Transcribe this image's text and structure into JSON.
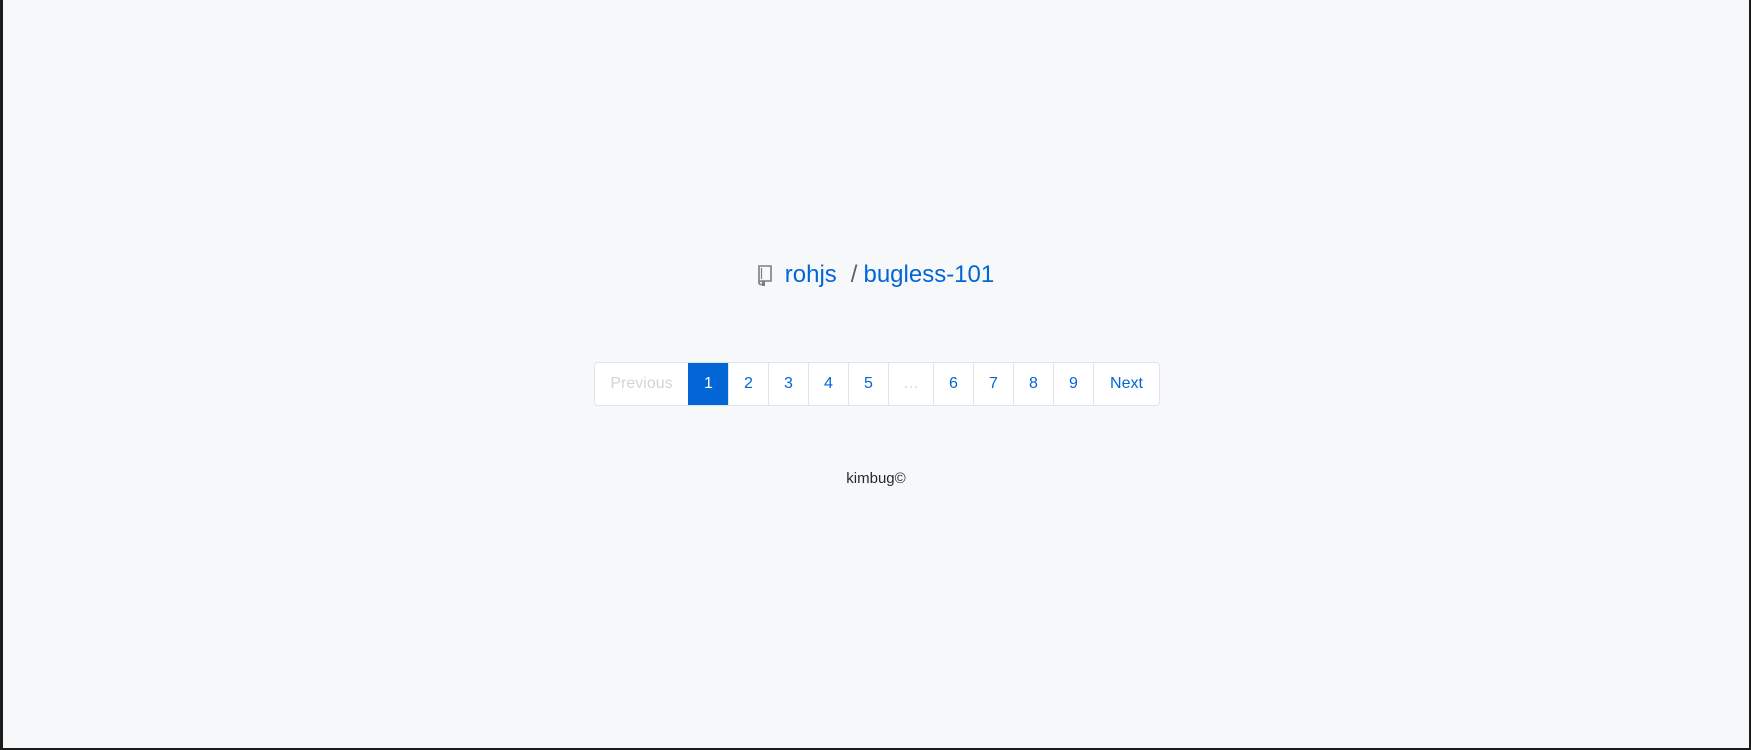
{
  "repo": {
    "icon": "repo-icon",
    "owner": "rohjs",
    "separator": "/",
    "name": "bugless-101"
  },
  "pagination": {
    "previous_label": "Previous",
    "pages": [
      "1",
      "2",
      "3",
      "4",
      "5"
    ],
    "gap": "…",
    "pages_after_gap": [
      "6",
      "7",
      "8",
      "9"
    ],
    "next_label": "Next",
    "current_page": "1"
  },
  "footer": {
    "text": "kimbug©"
  },
  "colors": {
    "accent": "#0366d6",
    "background": "#f7f8fa",
    "disabled": "#d1d5da"
  }
}
